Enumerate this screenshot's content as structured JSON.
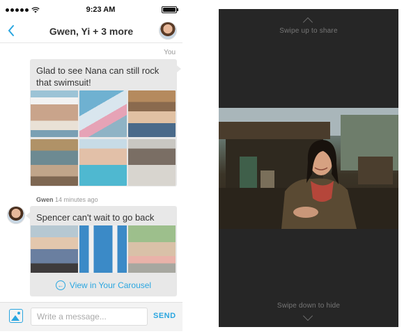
{
  "status_bar": {
    "time": "9:23 AM"
  },
  "nav": {
    "title": "Gwen, Yi + 3 more",
    "back_icon": "chevron-left-icon"
  },
  "conversation": {
    "you_label": "You",
    "message_1": {
      "text": "Glad to see Nana can still rock that swimsuit!",
      "photo_count": 6
    },
    "sender_name": "Gwen",
    "sender_time": "14 minutes ago",
    "message_2": {
      "text": "Spencer can't wait to go back",
      "photo_count": 3
    },
    "carousel_link": "View in Your Carousel"
  },
  "input_bar": {
    "placeholder": "Write a message...",
    "send_label": "SEND"
  },
  "viewer": {
    "swipe_up": "Swipe up to share",
    "swipe_down": "Swipe down to hide"
  },
  "colors": {
    "accent": "#2aa6e0",
    "bubble": "#e8e8e8",
    "viewer_bg": "#262626"
  }
}
